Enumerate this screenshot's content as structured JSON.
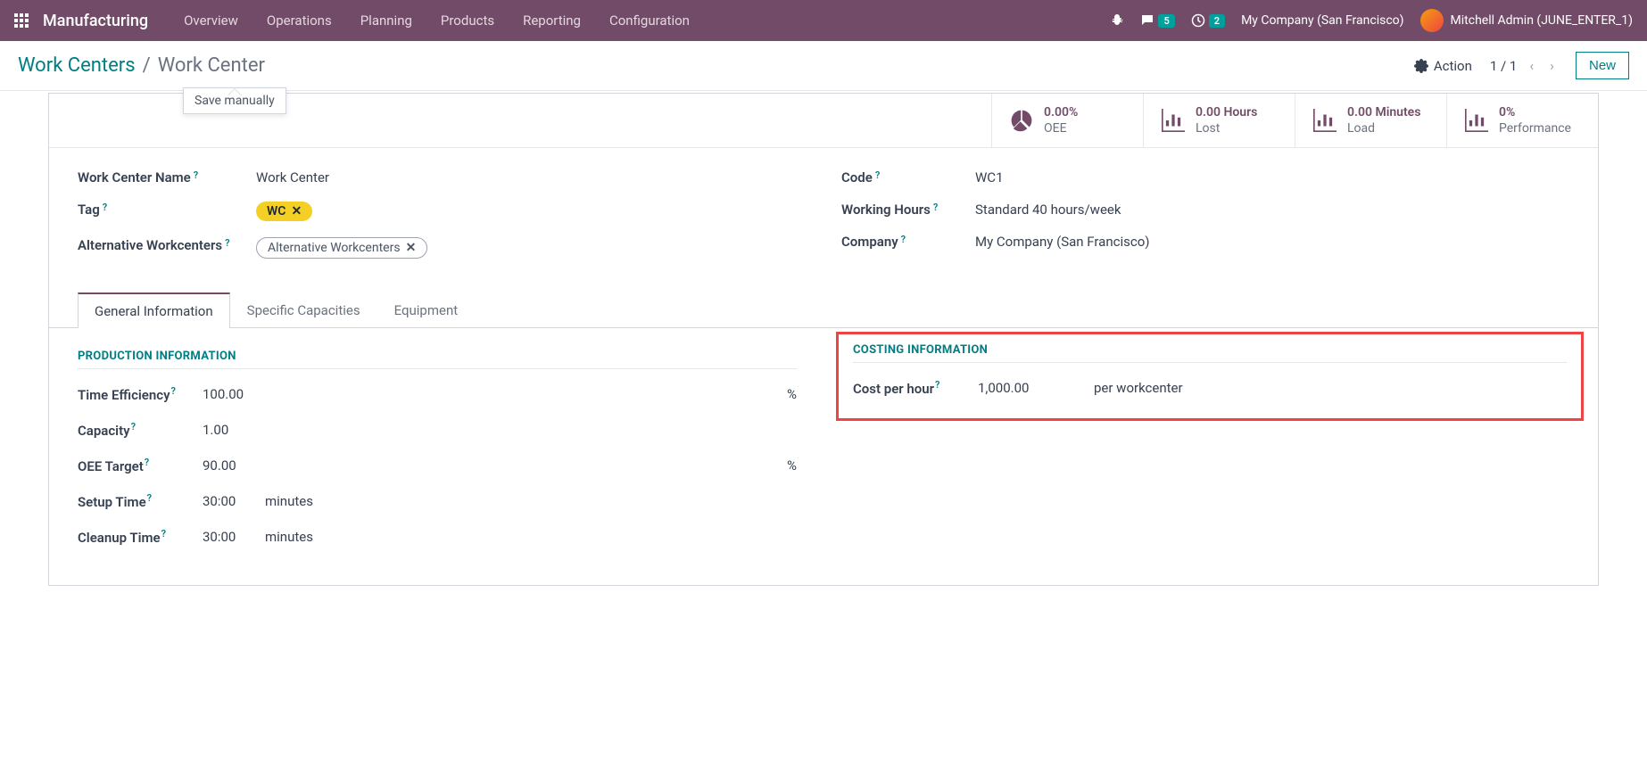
{
  "navbar": {
    "brand": "Manufacturing",
    "menu": [
      "Overview",
      "Operations",
      "Planning",
      "Products",
      "Reporting",
      "Configuration"
    ],
    "messages_count": "5",
    "activities_count": "2",
    "company": "My Company (San Francisco)",
    "user": "Mitchell Admin (JUNE_ENTER_1)"
  },
  "breadcrumb": {
    "parent": "Work Centers",
    "current": "Work Center",
    "tooltip": "Save manually"
  },
  "actions": {
    "action_label": "Action",
    "pager": "1 / 1",
    "new_label": "New"
  },
  "stats": {
    "oee": {
      "value": "0.00%",
      "label": "OEE"
    },
    "lost": {
      "value": "0.00 Hours",
      "label": "Lost"
    },
    "load": {
      "value": "0.00 Minutes",
      "label": "Load"
    },
    "performance": {
      "value": "0%",
      "label": "Performance"
    }
  },
  "fields": {
    "name_label": "Work Center Name",
    "name_value": "Work Center",
    "tag_label": "Tag",
    "tag_value": "WC",
    "alt_label": "Alternative Workcenters",
    "alt_value": "Alternative Workcenters",
    "code_label": "Code",
    "code_value": "WC1",
    "hours_label": "Working Hours",
    "hours_value": "Standard 40 hours/week",
    "company_label": "Company",
    "company_value": "My Company (San Francisco)"
  },
  "tabs": {
    "general": "General Information",
    "capacities": "Specific Capacities",
    "equipment": "Equipment"
  },
  "production": {
    "title": "PRODUCTION INFORMATION",
    "time_eff_label": "Time Efficiency",
    "time_eff_value": "100.00",
    "time_eff_unit": "%",
    "capacity_label": "Capacity",
    "capacity_value": "1.00",
    "oee_target_label": "OEE Target",
    "oee_target_value": "90.00",
    "oee_target_unit": "%",
    "setup_label": "Setup Time",
    "setup_value": "30:00",
    "setup_unit": "minutes",
    "cleanup_label": "Cleanup Time",
    "cleanup_value": "30:00",
    "cleanup_unit": "minutes"
  },
  "costing": {
    "title": "COSTING INFORMATION",
    "cost_label": "Cost per hour",
    "cost_value": "1,000.00",
    "cost_unit": "per workcenter"
  }
}
